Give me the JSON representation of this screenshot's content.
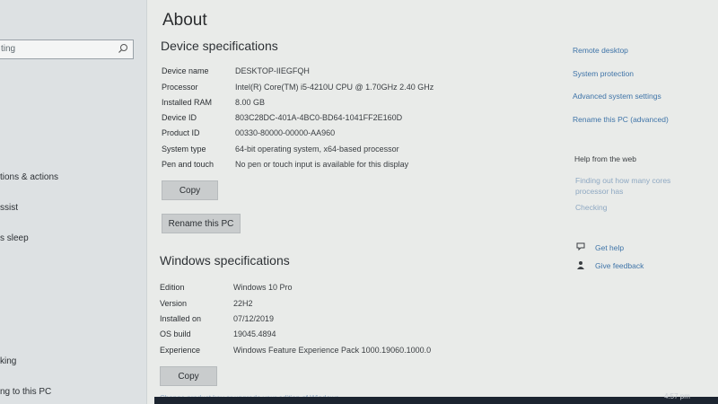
{
  "sidebar": {
    "search_value": "ting",
    "items": [
      "tions & actions",
      "ssist",
      "s sleep",
      "king",
      "ng to this PC"
    ]
  },
  "about": {
    "title": "About",
    "device_heading": "Device specifications",
    "device_specs": [
      {
        "label": "Device name",
        "value": "DESKTOP-IIEGFQH"
      },
      {
        "label": "Processor",
        "value": "Intel(R) Core(TM) i5-4210U CPU @ 1.70GHz   2.40 GHz"
      },
      {
        "label": "Installed RAM",
        "value": "8.00 GB"
      },
      {
        "label": "Device ID",
        "value": "803C28DC-401A-4BC0-BD64-1041FF2E160D"
      },
      {
        "label": "Product ID",
        "value": "00330-80000-00000-AA960"
      },
      {
        "label": "System type",
        "value": "64-bit operating system, x64-based processor"
      },
      {
        "label": "Pen and touch",
        "value": "No pen or touch input is available for this display"
      }
    ],
    "copy_label": "Copy",
    "rename_label": "Rename this PC",
    "windows_heading": "Windows specifications",
    "windows_specs": [
      {
        "label": "Edition",
        "value": "Windows 10 Pro"
      },
      {
        "label": "Version",
        "value": "22H2"
      },
      {
        "label": "Installed on",
        "value": "07/12/2019"
      },
      {
        "label": "OS build",
        "value": "19045.4894"
      },
      {
        "label": "Experience",
        "value": "Windows Feature Experience Pack 1000.19060.1000.0"
      }
    ],
    "copy2_label": "Copy",
    "bottom_cut_text": "Change product key or upgrade your edition of Windows"
  },
  "related": {
    "links": [
      "Remote desktop",
      "System protection",
      "Advanced system settings",
      "Rename this PC (advanced)"
    ],
    "help_heading": "Help from the web",
    "help_links": [
      "Finding out how many cores",
      "processor has",
      "Checking"
    ],
    "get_help": "Get help",
    "give_feedback": "Give feedback"
  },
  "taskbar": {
    "clock": "4:57 pm"
  }
}
